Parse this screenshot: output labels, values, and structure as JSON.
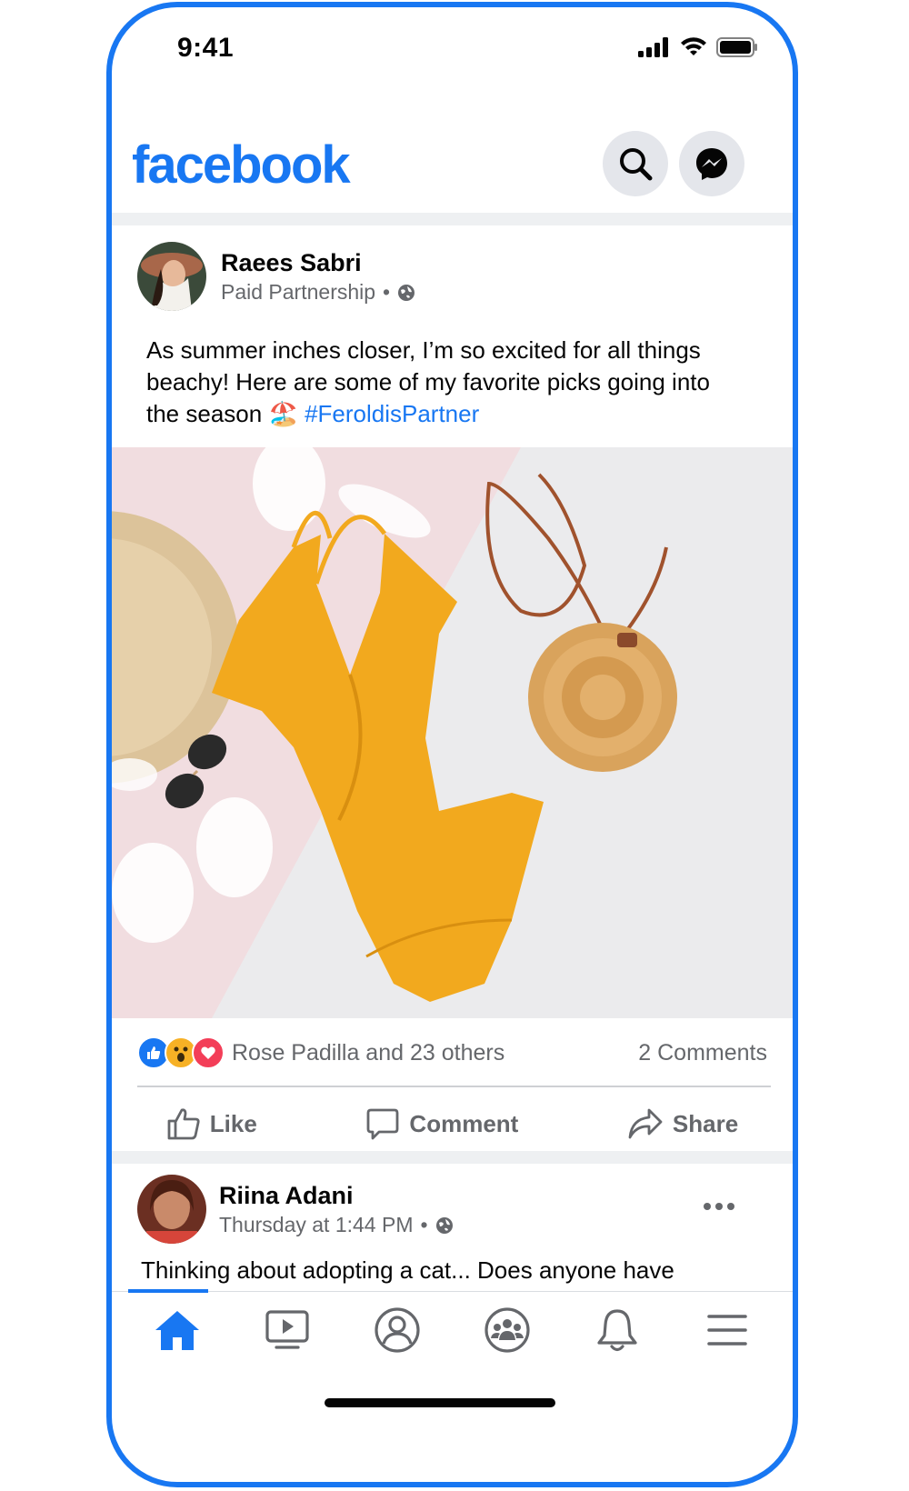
{
  "status_bar": {
    "time": "9:41"
  },
  "app": {
    "logo": "facebook"
  },
  "header": {
    "search_icon": "search-icon",
    "messenger_icon": "messenger-icon"
  },
  "post1": {
    "author": "Raees Sabri",
    "meta": "Paid Partnership",
    "text_main": "As summer inches closer, I’m so excited for all things beachy! Here are some of my favorite picks going into the season",
    "emoji": "🏖️",
    "hashtag": "#FeroldisPartner",
    "reactions_text": "Rose Padilla and 23 others",
    "comments_count": "2 Comments",
    "actions": {
      "like": "Like",
      "comment": "Comment",
      "share": "Share"
    }
  },
  "post2": {
    "author": "Riina Adani",
    "meta": "Thursday at 1:44 PM",
    "text": "Thinking about adopting a cat... Does anyone have"
  },
  "nav": [
    "home-icon",
    "watch-icon",
    "profile-icon",
    "groups-icon",
    "notifications-icon",
    "menu-icon"
  ],
  "colors": {
    "brand": "#1877f2",
    "secondary_text": "#65676b",
    "like": "#1877f2",
    "love": "#f33e58",
    "wow": "#f7b125"
  }
}
